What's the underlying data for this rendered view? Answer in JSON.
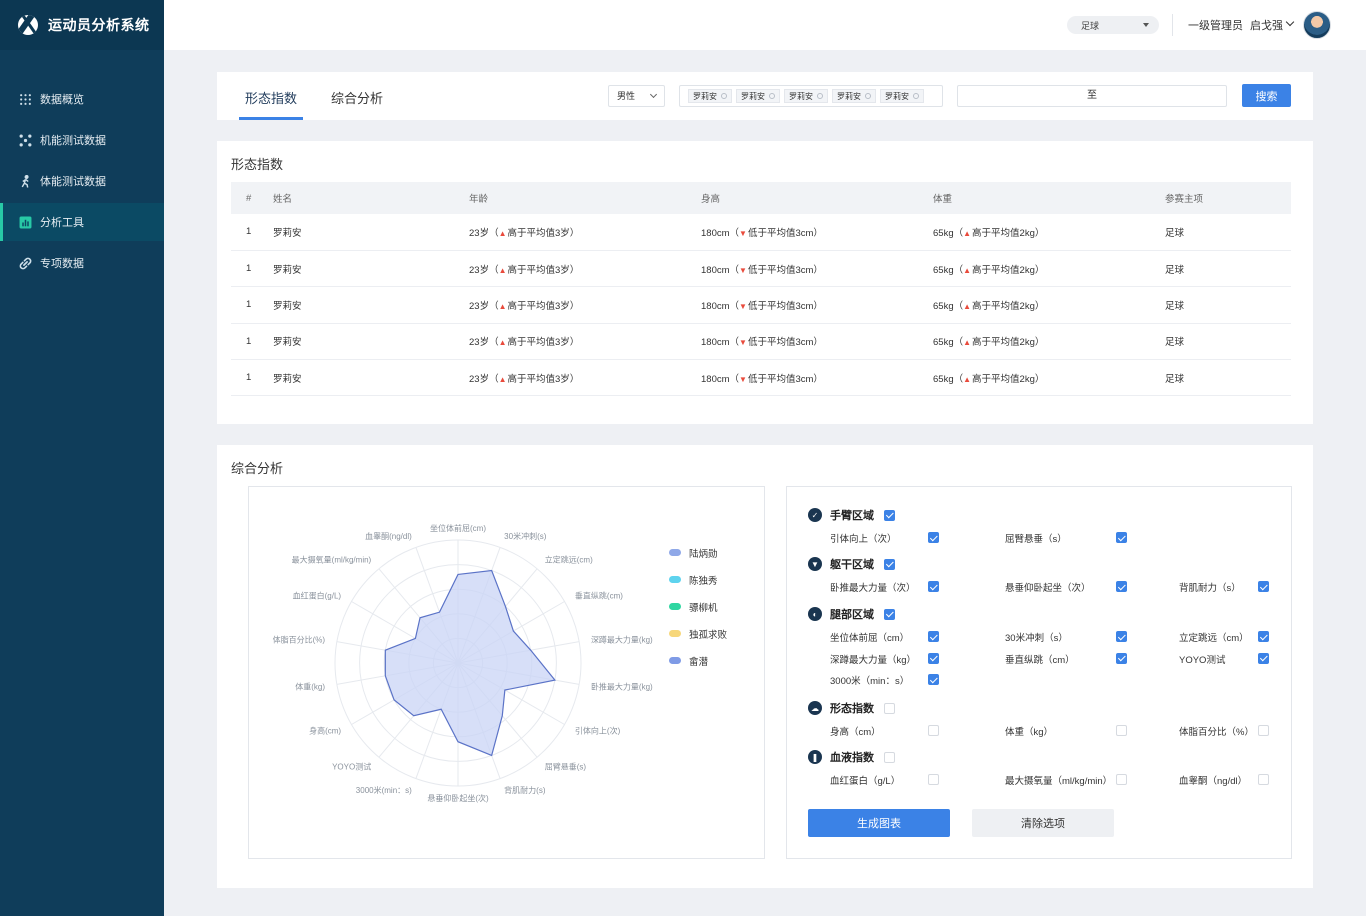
{
  "app": {
    "title": "运动员分析系统"
  },
  "sidebar": {
    "items": [
      {
        "label": "数据概览",
        "icon": "grid-dots-icon",
        "active": false
      },
      {
        "label": "机能测试数据",
        "icon": "molecule-icon",
        "active": false
      },
      {
        "label": "体能测试数据",
        "icon": "running-person-icon",
        "active": false
      },
      {
        "label": "分析工具",
        "icon": "bar-chart-icon",
        "active": true
      },
      {
        "label": "专项数据",
        "icon": "link-icon",
        "active": false
      }
    ]
  },
  "topbar": {
    "sport": "足球",
    "role": "一级管理员",
    "username": "启戈强"
  },
  "tabs": {
    "items": [
      "形态指数",
      "综合分析"
    ],
    "active": 0
  },
  "filters": {
    "gender": "男性",
    "athletes": [
      "罗莉安",
      "罗莉安",
      "罗莉安",
      "罗莉安",
      "罗莉安"
    ],
    "date_separator": "至",
    "search_label": "搜索"
  },
  "morphology": {
    "title": "形态指数",
    "columns": [
      "#",
      "姓名",
      "年龄",
      "身高",
      "体重",
      "参赛主项"
    ],
    "rows": [
      {
        "idx": "1",
        "name": "罗莉安",
        "age": "23岁（",
        "age_note": "高于平均值3岁）",
        "height": "180cm（",
        "height_note": "低于平均值3cm）",
        "weight": "65kg（",
        "weight_note": "高于平均值2kg）",
        "sport": "足球"
      },
      {
        "idx": "1",
        "name": "罗莉安",
        "age": "23岁（",
        "age_note": "高于平均值3岁）",
        "height": "180cm（",
        "height_note": "低于平均值3cm）",
        "weight": "65kg（",
        "weight_note": "高于平均值2kg）",
        "sport": "足球"
      },
      {
        "idx": "1",
        "name": "罗莉安",
        "age": "23岁（",
        "age_note": "高于平均值3岁）",
        "height": "180cm（",
        "height_note": "低于平均值3cm）",
        "weight": "65kg（",
        "weight_note": "高于平均值2kg）",
        "sport": "足球"
      },
      {
        "idx": "1",
        "name": "罗莉安",
        "age": "23岁（",
        "age_note": "高于平均值3岁）",
        "height": "180cm（",
        "height_note": "低于平均值3cm）",
        "weight": "65kg（",
        "weight_note": "高于平均值2kg）",
        "sport": "足球"
      },
      {
        "idx": "1",
        "name": "罗莉安",
        "age": "23岁（",
        "age_note": "高于平均值3岁）",
        "height": "180cm（",
        "height_note": "低于平均值3cm）",
        "weight": "65kg（",
        "weight_note": "高于平均值2kg）",
        "sport": "足球"
      }
    ]
  },
  "analysis": {
    "title": "综合分析",
    "legend": [
      {
        "name": "陆炳勋",
        "color": "#8fa8e8"
      },
      {
        "name": "陈独秀",
        "color": "#5ed3ee"
      },
      {
        "name": "骠柳机",
        "color": "#2fd6a1"
      },
      {
        "name": "独孤求败",
        "color": "#f7d77a"
      },
      {
        "name": "畲潜",
        "color": "#7f9be6"
      }
    ],
    "groups": [
      {
        "title": "手臂区域",
        "icon": "arm-icon",
        "glyph": "✓",
        "checked": true,
        "options": [
          {
            "label": "引体向上（次）",
            "checked": true
          },
          {
            "label": "屈臂悬垂（s）",
            "checked": true
          }
        ]
      },
      {
        "title": "躯干区域",
        "icon": "torso-icon",
        "glyph": "▼",
        "checked": true,
        "options": [
          {
            "label": "卧推最大力量（次）",
            "checked": true
          },
          {
            "label": "悬垂仰卧起坐（次）",
            "checked": true
          },
          {
            "label": "背肌耐力（s）",
            "checked": true
          }
        ]
      },
      {
        "title": "腿部区域",
        "icon": "leg-icon",
        "glyph": "◐",
        "checked": true,
        "options": [
          {
            "label": "坐位体前屈（cm）",
            "checked": true
          },
          {
            "label": "30米冲刺（s）",
            "checked": true
          },
          {
            "label": "立定跳远（cm）",
            "checked": true
          },
          {
            "label": "深蹲最大力量（kg）",
            "checked": true
          },
          {
            "label": "垂直纵跳（cm）",
            "checked": true
          },
          {
            "label": "YOYO测试",
            "checked": true
          },
          {
            "label": "3000米（min：s）",
            "checked": true
          }
        ]
      },
      {
        "title": "形态指数",
        "icon": "body-shape-icon",
        "glyph": "☁",
        "checked": false,
        "options": [
          {
            "label": "身高（cm）",
            "checked": false
          },
          {
            "label": "体重（kg）",
            "checked": false
          },
          {
            "label": "体脂百分比（%）",
            "checked": false
          }
        ]
      },
      {
        "title": "血液指数",
        "icon": "blood-drop-icon",
        "glyph": "❚",
        "checked": false,
        "options": [
          {
            "label": "血红蛋白（g/L）",
            "checked": false
          },
          {
            "label": "最大摄氧量（ml/kg/min）",
            "checked": false
          },
          {
            "label": "血睾酮（ng/dl）",
            "checked": false
          }
        ]
      }
    ],
    "generate_label": "生成图表",
    "clear_label": "清除选项"
  },
  "chart_data": {
    "type": "radar",
    "axes": [
      "坐位体前屈(cm)",
      "30米冲刺(s)",
      "立定跳远(cm)",
      "垂直纵跳(cm)",
      "深蹲最大力量(kg)",
      "卧推最大力量(kg)",
      "引体向上(次)",
      "屈臂悬垂(s)",
      "背肌耐力(s)",
      "悬垂仰卧起坐(次)",
      "3000米(min：s)",
      "YOYO测试",
      "身高(cm)",
      "体重(kg)",
      "体脂百分比(%)",
      "血红蛋白(g/L)",
      "最大摄氧量(ml/kg/min)",
      "血睾酮(ng/dl)"
    ],
    "rmax": 5,
    "rings": 5,
    "series": [
      {
        "color": "#5b73c7",
        "fill": "#c9d4f6",
        "values": [
          3.6,
          4.0,
          3.0,
          2.6,
          3.0,
          4.0,
          2.2,
          2.8,
          4.0,
          3.2,
          2.0,
          2.8,
          3.0,
          3.0,
          3.0,
          2.0,
          2.4,
          2.2
        ]
      }
    ],
    "grid": true
  }
}
